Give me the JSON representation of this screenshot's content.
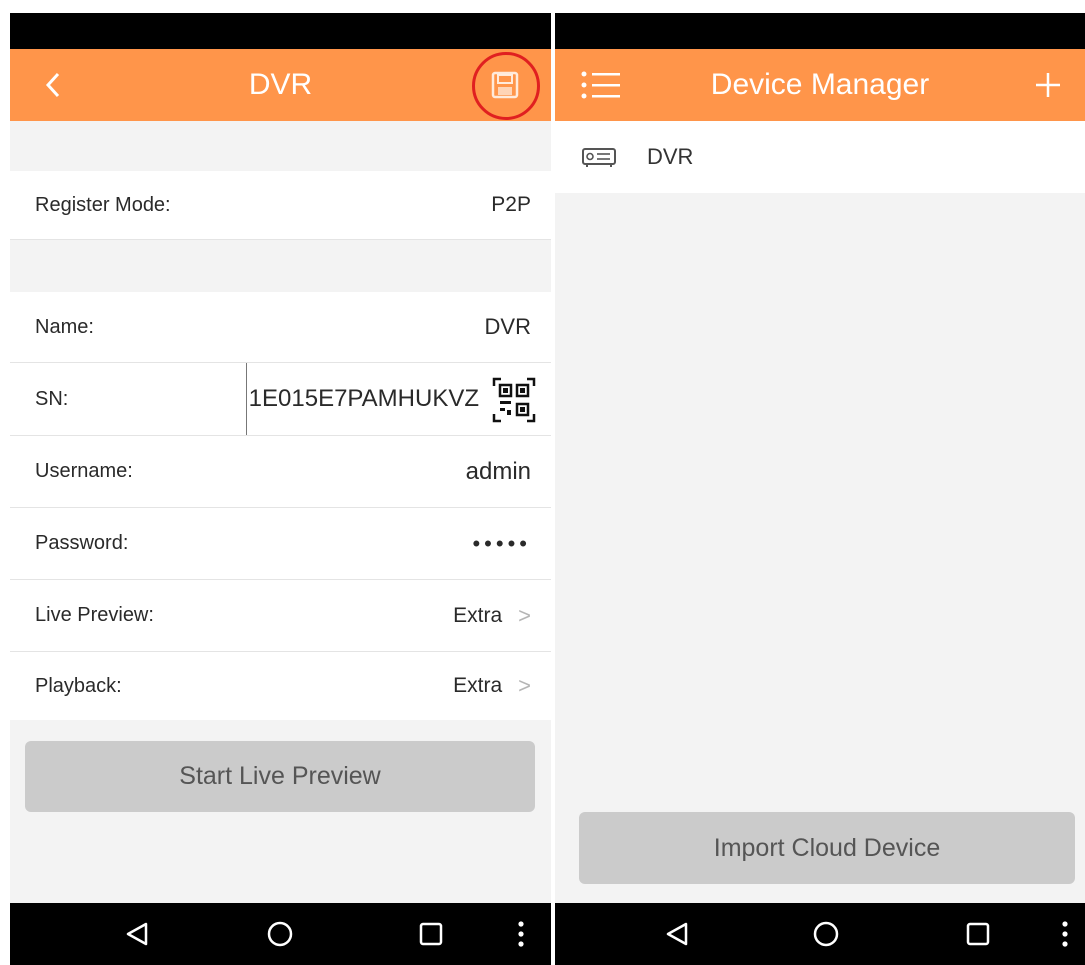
{
  "left_screen": {
    "title": "DVR",
    "icons": {
      "back": "chevron-left-icon",
      "save": "save-icon"
    },
    "register_mode": {
      "label": "Register Mode:",
      "value": "P2P"
    },
    "fields": {
      "name": {
        "label": "Name:",
        "value": "DVR"
      },
      "sn": {
        "label": "SN:",
        "value": "1E015E7PAMHUKVZ"
      },
      "username": {
        "label": "Username:",
        "value": "admin"
      },
      "password": {
        "label": "Password:",
        "value": "•••••"
      },
      "live_preview": {
        "label": "Live Preview:",
        "value": "Extra"
      },
      "playback": {
        "label": "Playback:",
        "value": "Extra"
      }
    },
    "start_button": "Start Live Preview"
  },
  "right_screen": {
    "title": "Device Manager",
    "icons": {
      "menu": "list-menu-icon",
      "add": "plus-icon",
      "device": "dvr-device-icon"
    },
    "devices": [
      {
        "name": "DVR"
      }
    ],
    "import_button": "Import Cloud Device"
  },
  "nav": {
    "back": "triangle-back-icon",
    "home": "circle-home-icon",
    "recents": "square-recents-icon",
    "more": "dots-more-icon"
  },
  "colors": {
    "accent": "#ff954a",
    "highlight_circle": "#e02020"
  }
}
